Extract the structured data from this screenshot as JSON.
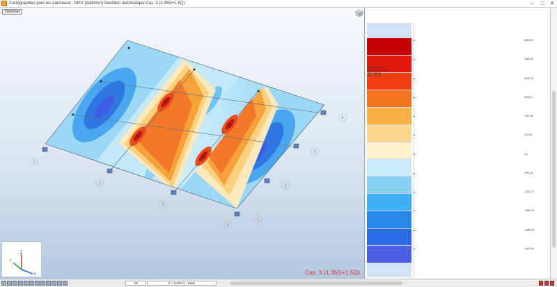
{
  "window": {
    "title": "Cartographies pour les panneaux - MXX [daNm/m] Direction automatique Cas: 3 (1.35G+1.5Q)"
  },
  "viewport": {
    "finish_label": "Terminer",
    "case_label": "Cas: 3 (1.35G+1.5Q)",
    "support_labels": [
      {
        "id": "support-label-1-left",
        "text": "1"
      },
      {
        "id": "support-label-2-left",
        "text": "2"
      },
      {
        "id": "support-label-3-front",
        "text": "3"
      },
      {
        "id": "support-label-4-front",
        "text": "4"
      },
      {
        "id": "support-label-4-right",
        "text": "4"
      },
      {
        "id": "support-label-3-right",
        "text": "3"
      },
      {
        "id": "support-label-2-right",
        "text": "2"
      },
      {
        "id": "support-label-1-right",
        "text": "1"
      }
    ]
  },
  "legend": {
    "info": [
      "MXX [daNm/m]",
      "Direction automatique",
      "Max: 4899,50",
      "Min: -2593,96"
    ],
    "colors": [
      "#c40000",
      "#e01a0c",
      "#f03f12",
      "#f5741e",
      "#f9b24a",
      "#fbd98f",
      "#fdf0cc",
      "#c9ecf8",
      "#86d0f5",
      "#3fb0f3",
      "#2787ea",
      "#2c6be6",
      "#4d5ee6"
    ],
    "ticks": [
      "4899,50",
      "3966,39",
      "3033,28",
      "2100,17",
      "1167,06",
      "233,95",
      "0,0",
      "-699,16",
      "-1632,27",
      "-2565,38",
      "-3498,49",
      "-4431,60"
    ]
  },
  "statusbar": {
    "field_1": "3D",
    "field_2": "Z = 0,000 m - Base"
  },
  "axis": {
    "x": "X",
    "y": "Y",
    "z": "Z"
  }
}
